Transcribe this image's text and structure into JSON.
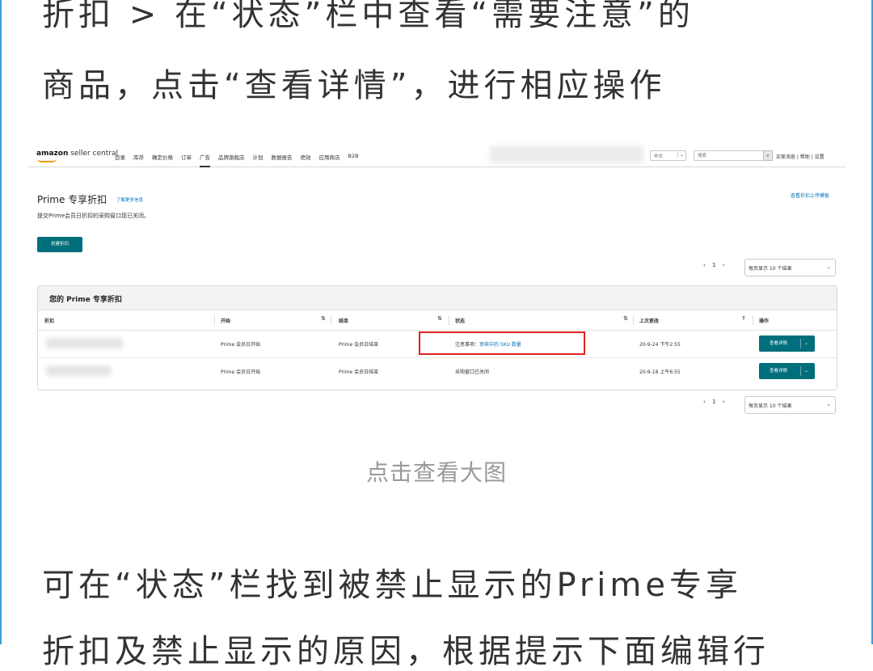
{
  "article": {
    "line1": "折扣 > 在“状态”栏中查看“需要注意”的",
    "line2": "商品，点击“查看详情”，进行相应操作",
    "caption": "点击查看大图",
    "line3": "可在“状态”栏找到被禁止显示的Prime专享",
    "line4": "折扣及禁止显示的原因，根据提示下面编辑行"
  },
  "screenshot": {
    "logo_bold": "amazon",
    "logo_thin": " seller central",
    "nav": [
      "目录",
      "库存",
      "确定价格",
      "订单",
      "广告",
      "品牌旗舰店",
      "计划",
      "数据报告",
      "绩效",
      "应用商店",
      "B2B"
    ],
    "nav_active": "广告",
    "language": "中文",
    "search_placeholder": "搜索",
    "top_links": "买家消息 | 帮助 | 设置",
    "page_title": "Prime 专享折扣",
    "learn_more": "了解更多信息",
    "notice": "提交Prime会员日折扣的采购窗口现已关闭。",
    "top_right_link": "查看折扣上传模板",
    "create_button": "创建折扣",
    "pager": "‹ 1 ›",
    "per_page": "每页显示 10 个结果",
    "table_title": "您的 Prime 专享折扣",
    "columns": [
      "折扣",
      "开始",
      "结束",
      "状态",
      "上次更改",
      "操作"
    ],
    "rows": [
      {
        "start": "Prime 会员日开始",
        "end": "Prime 会员日结束",
        "status_prefix": "注意事项：",
        "status_link": "审核中的 SKU 数量",
        "updated": "20-9-24 下午2:55",
        "action": "查看详情"
      },
      {
        "start": "Prime 会员日开始",
        "end": "Prime 会员日结束",
        "status_prefix": "采购窗口已关闭",
        "status_link": "",
        "updated": "20-9-18 上午6:55",
        "action": "查看详情"
      }
    ],
    "highlight_color": "#e02020",
    "accent_color": "#006e7b",
    "icons": {
      "sort": "sort-arrows-icon",
      "sort_up": "arrow-up-icon",
      "dropdown": "chevron-down-icon",
      "search": "search-icon"
    }
  }
}
